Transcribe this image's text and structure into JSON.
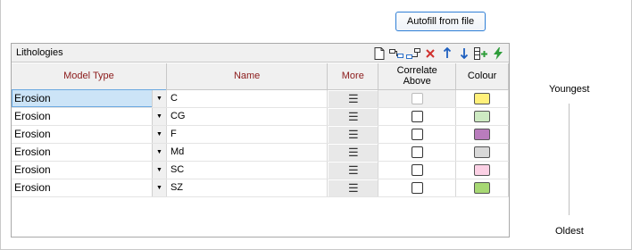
{
  "toolbar_top": {
    "autofill_label": "Autofill from file"
  },
  "panel": {
    "title": "Lithologies",
    "toolbar_icons": [
      "new-document-icon",
      "insert-row-icon",
      "append-row-icon",
      "delete-icon",
      "move-up-icon",
      "move-down-icon",
      "add-column-icon",
      "lightning-icon"
    ]
  },
  "grid": {
    "headers": {
      "model_type": "Model Type",
      "name": "Name",
      "more": "More",
      "correlate_line1": "Correlate",
      "correlate_line2": "Above",
      "colour": "Colour"
    },
    "more_glyph": "☰",
    "dropdown_glyph": "▼",
    "rows": [
      {
        "model_type": "Erosion",
        "name": "C",
        "colour": "#fff07a",
        "correlate": false,
        "correlate_disabled": true
      },
      {
        "model_type": "Erosion",
        "name": "CG",
        "colour": "#cdeac2",
        "correlate": false,
        "correlate_disabled": false
      },
      {
        "model_type": "Erosion",
        "name": "F",
        "colour": "#b97cbd",
        "correlate": false,
        "correlate_disabled": false
      },
      {
        "model_type": "Erosion",
        "name": "Md",
        "colour": "#d9d9d9",
        "correlate": false,
        "correlate_disabled": false
      },
      {
        "model_type": "Erosion",
        "name": "SC",
        "colour": "#fbd0e4",
        "correlate": false,
        "correlate_disabled": false
      },
      {
        "model_type": "Erosion",
        "name": "SZ",
        "colour": "#a7d874",
        "correlate": false,
        "correlate_disabled": false
      }
    ]
  },
  "age_scale": {
    "top_label": "Youngest",
    "bottom_label": "Oldest"
  }
}
